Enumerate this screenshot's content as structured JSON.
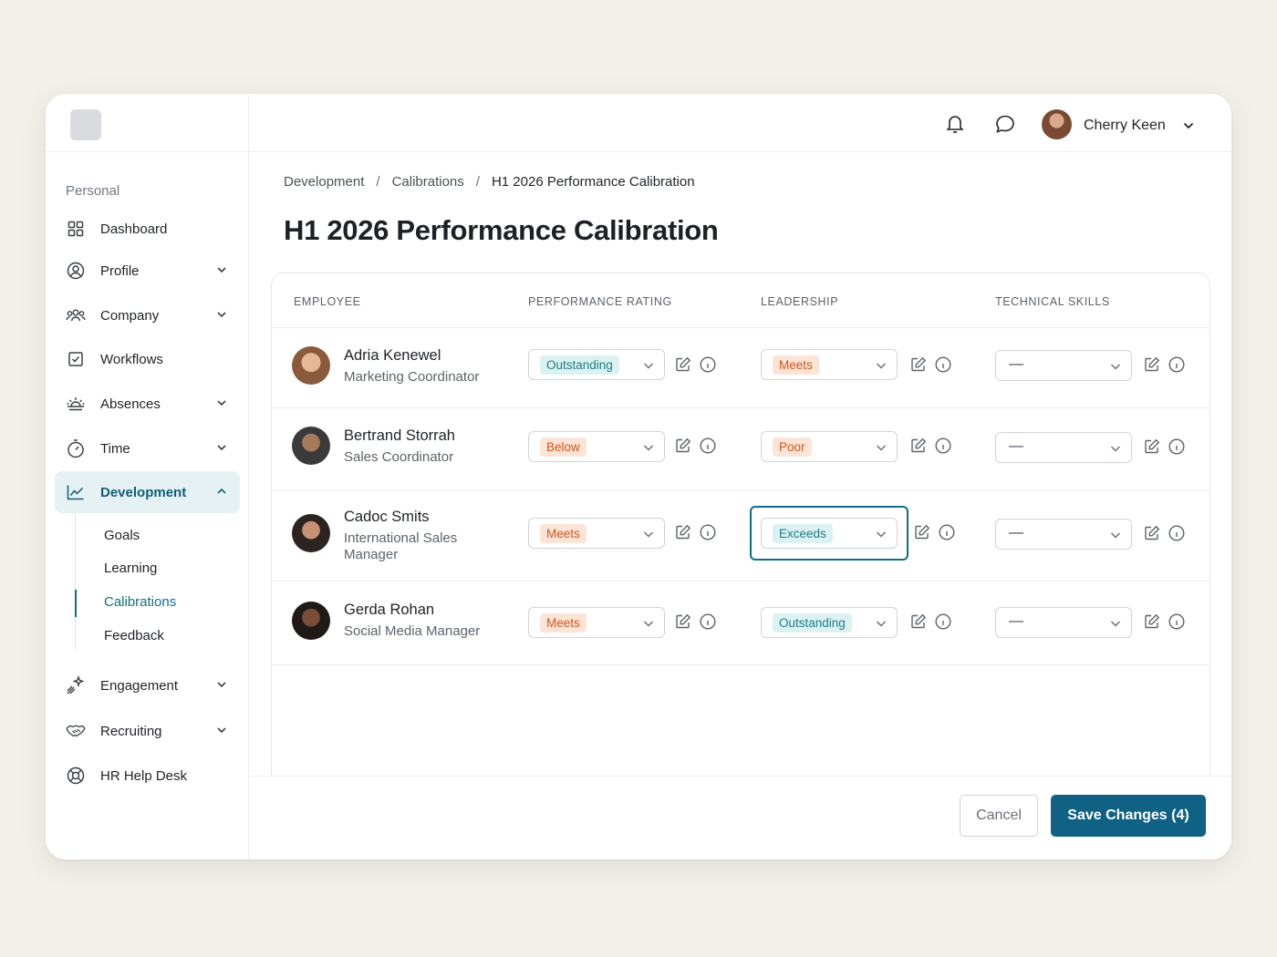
{
  "header": {
    "user_name": "Cherry Keen"
  },
  "sidebar": {
    "section_label": "Personal",
    "items": [
      {
        "label": "Dashboard",
        "icon": "grid-icon"
      },
      {
        "label": "Profile",
        "icon": "user-circle-icon"
      },
      {
        "label": "Company",
        "icon": "team-icon"
      },
      {
        "label": "Workflows",
        "icon": "checkbox-icon"
      },
      {
        "label": "Absences",
        "icon": "sunrise-icon"
      },
      {
        "label": "Time",
        "icon": "stopwatch-icon"
      },
      {
        "label": "Development",
        "icon": "trend-chart-icon"
      },
      {
        "label": "Engagement",
        "icon": "sparkle-icon"
      },
      {
        "label": "Recruiting",
        "icon": "handshake-icon"
      },
      {
        "label": "HR Help Desk",
        "icon": "lifebuoy-icon"
      }
    ],
    "sub_items": [
      "Goals",
      "Learning",
      "Calibrations",
      "Feedback"
    ]
  },
  "breadcrumb": [
    "Development",
    "Calibrations",
    "H1 2026 Performance Calibration"
  ],
  "breadcrumb_separator": "/",
  "page_title": "H1 2026 Performance Calibration",
  "table": {
    "headers": [
      "EMPLOYEE",
      "PERFORMANCE RATING",
      "LEADERSHIP",
      "TECHNICAL SKILLS"
    ],
    "rows": [
      {
        "name": "Adria Kenewel",
        "role": "Marketing Coordinator",
        "performance": "Outstanding",
        "leadership": "Meets",
        "technical": "—"
      },
      {
        "name": "Bertrand Storrah",
        "role": "Sales Coordinator",
        "performance": "Below",
        "leadership": "Poor",
        "technical": "—"
      },
      {
        "name": "Cadoc Smits",
        "role": "International Sales Manager",
        "performance": "Meets",
        "leadership": "Exceeds",
        "technical": "—"
      },
      {
        "name": "Gerda Rohan",
        "role": "Social Media Manager",
        "performance": "Meets",
        "leadership": "Outstanding",
        "technical": "—"
      }
    ]
  },
  "footer": {
    "cancel_label": "Cancel",
    "save_label": "Save Changes (4)"
  },
  "colors": {
    "accent": "#0f6283",
    "teal_pill_bg": "#dcf1f1",
    "orange_pill_bg": "#fde4d6"
  }
}
